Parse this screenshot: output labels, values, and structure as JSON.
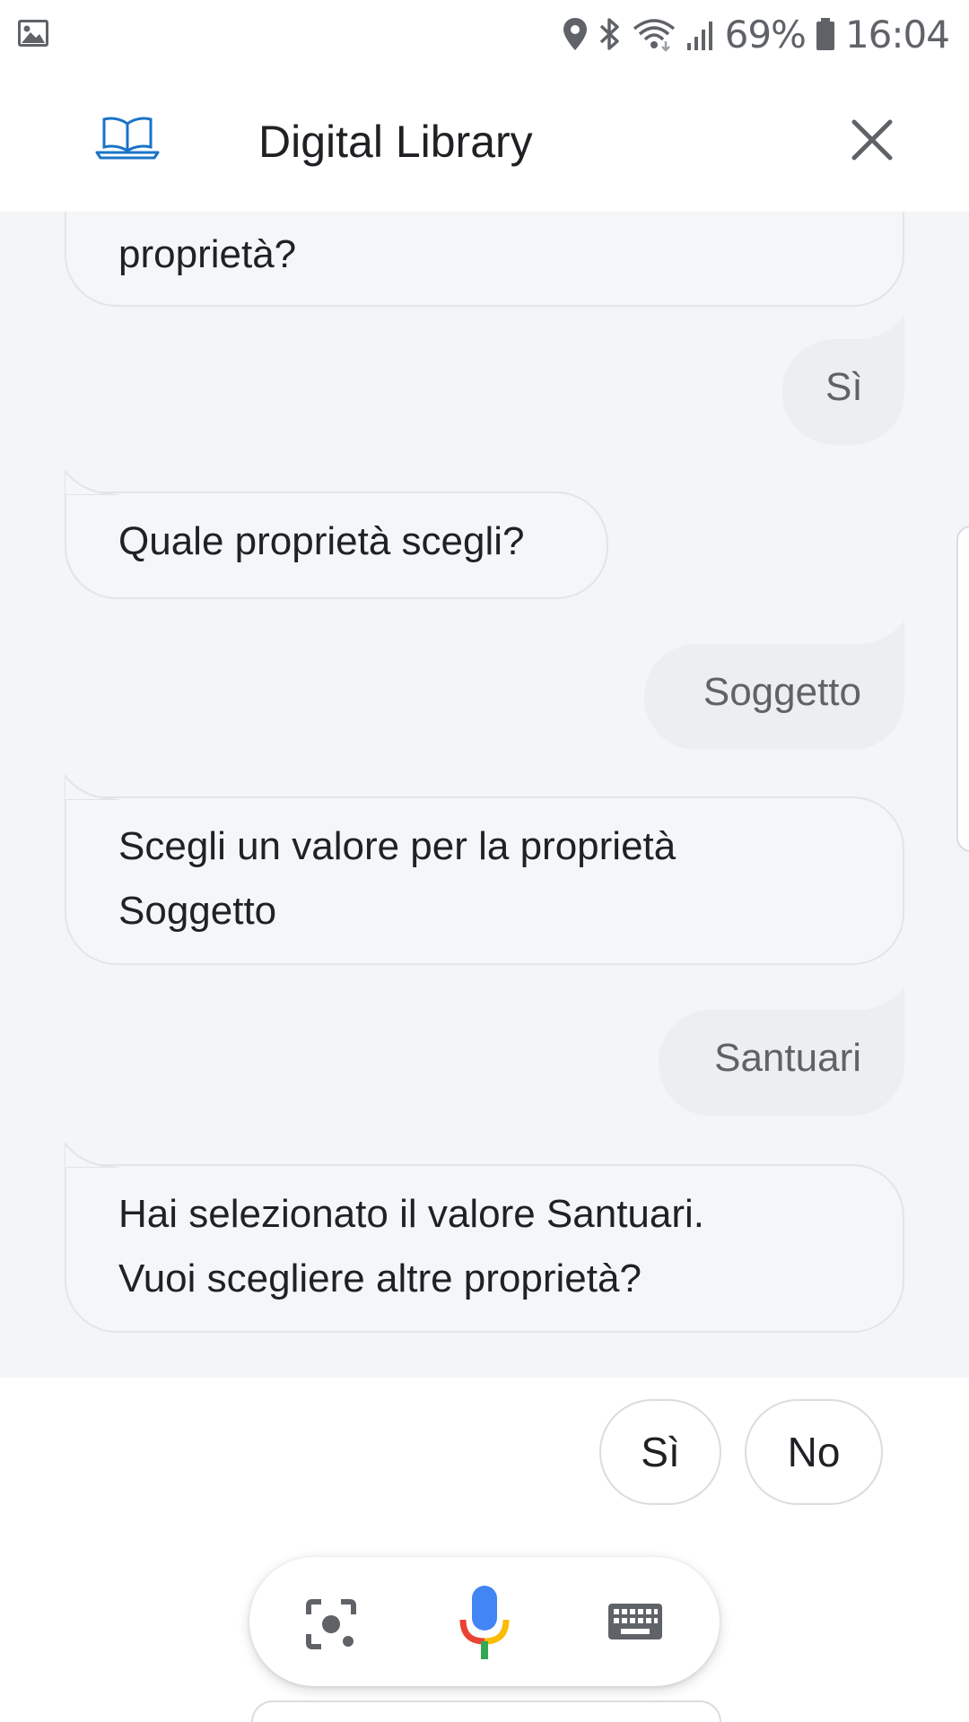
{
  "status_bar": {
    "battery": "69%",
    "time": "16:04",
    "icons": [
      "gallery-icon",
      "location-icon",
      "bluetooth-icon",
      "wifi-icon",
      "signal-icon",
      "battery-icon"
    ]
  },
  "header": {
    "title": "Digital Library",
    "logo_icon": "book-laptop-icon",
    "close_icon": "close-icon",
    "logo_color": "#1a73c8"
  },
  "conversation": [
    {
      "role": "assistant",
      "text": "proprietà?"
    },
    {
      "role": "user",
      "text": "Sì"
    },
    {
      "role": "assistant",
      "text": "Quale proprietà scegli?"
    },
    {
      "role": "user",
      "text": "Soggetto"
    },
    {
      "role": "assistant",
      "line1": "Scegli un valore per la proprietà",
      "line2": "Soggetto"
    },
    {
      "role": "user",
      "text": "Santuari"
    },
    {
      "role": "assistant",
      "line1": "Hai selezionato il valore Santuari.",
      "line2": "Vuoi scegliere altre proprietà?"
    }
  ],
  "suggestions": [
    "Sì",
    "No"
  ],
  "input_bar": {
    "icons": [
      "lens-icon",
      "mic-icon",
      "keyboard-icon"
    ]
  }
}
